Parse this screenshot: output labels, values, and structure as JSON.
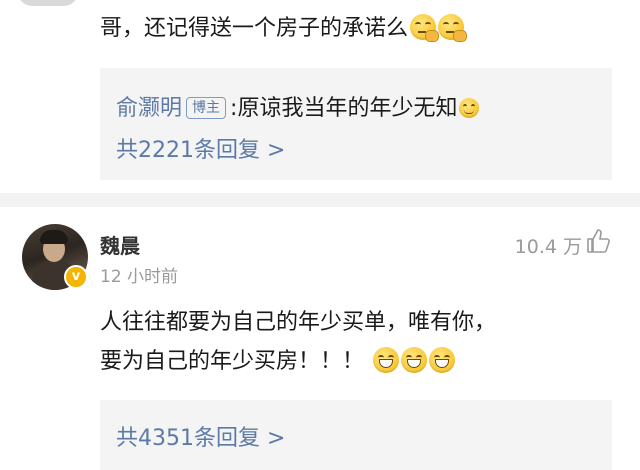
{
  "comment_top": {
    "text": "哥，还记得送一个房子的承诺么",
    "emojis": [
      "thinking-emoji",
      "thinking-emoji"
    ],
    "reply": {
      "author": "俞灏明",
      "badge": "博主",
      "separator": ":",
      "text": "原谅我当年的年少无知",
      "emoji": "smile-emoji",
      "count_label": "共2221条回复 >"
    }
  },
  "comment_main": {
    "username": "魏晨",
    "time": "12 小时前",
    "likes": "10.4 万",
    "verified_mark": "v",
    "text_line1": "人往往都要为自己的年少买单，唯有你，",
    "text_line2": "要为自己的年少买房！！！",
    "emojis": [
      "grin-emoji",
      "grin-emoji",
      "grin-emoji"
    ],
    "reply_count_label": "共4351条回复 >"
  },
  "colors": {
    "link_blue": "#5b7aa5",
    "reply_bg": "#f4f4f4",
    "muted": "#9a9a9a",
    "verified": "#f5b400"
  }
}
